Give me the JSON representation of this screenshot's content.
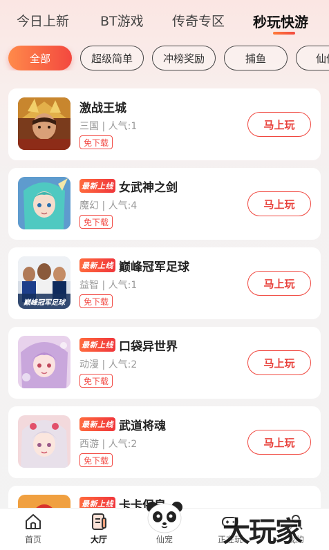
{
  "top_tabs": {
    "tab1": "今日上新",
    "tab2": "BT游戏",
    "tab3": "传奇专区",
    "tab4": "秒玩快游"
  },
  "chips": {
    "c1": "全部",
    "c2": "超级简单",
    "c3": "冲榜奖励",
    "c4": "捕鱼",
    "c5": "仙侠"
  },
  "games": [
    {
      "title": "激战王城",
      "meta": "三国 | 人气:1",
      "tag": "免下载",
      "button": "马上玩"
    },
    {
      "badge": "最新上线",
      "title": "女武神之剑",
      "meta": "魔幻 | 人气:4",
      "tag": "免下载",
      "button": "马上玩"
    },
    {
      "badge": "最新上线",
      "title": "巅峰冠军足球",
      "meta": "益智 | 人气:1",
      "tag": "免下载",
      "button": "马上玩"
    },
    {
      "badge": "最新上线",
      "title": "口袋异世界",
      "meta": "动漫 | 人气:2",
      "tag": "免下载",
      "button": "马上玩"
    },
    {
      "badge": "最新上线",
      "title": "武道将魂",
      "meta": "西游 | 人气:2",
      "tag": "免下载",
      "button": "马上玩"
    },
    {
      "badge": "最新上线",
      "title": "卡卡保皇"
    }
  ],
  "thumb_texts": {
    "football": "巅峰冠军足球"
  },
  "bottom_nav": {
    "home": "首页",
    "hall": "大厅",
    "pet": "仙宠",
    "playing": "正在玩",
    "mine": "我的"
  },
  "watermark": "大玩家",
  "colors": {
    "accent": "#f0473f",
    "accent_gradient_start": "#ff8a4a",
    "background_top": "#fbe6e3"
  },
  "icons": {
    "home": "home-icon",
    "hall": "hall-icon",
    "pet": "panda-pet-icon",
    "playing": "gamepad-icon",
    "mine": "user-icon"
  }
}
